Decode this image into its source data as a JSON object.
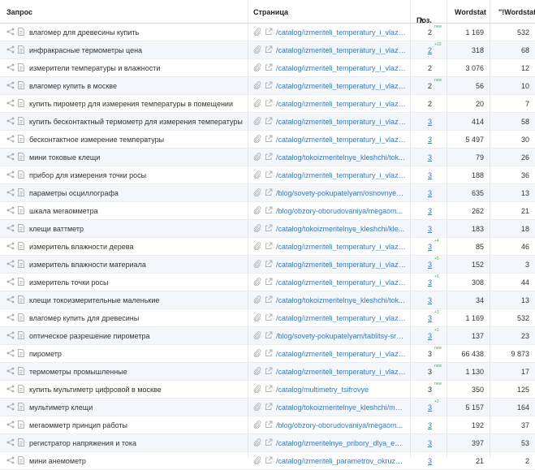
{
  "headers": {
    "query": "Запрос",
    "page": "Страница",
    "pos": "Поз.",
    "wordstat": "Wordstat",
    "exact_wordstat": "\"!Wordstat\""
  },
  "icons": {
    "share": "share-icon",
    "doc": "document-icon",
    "clip": "paperclip-icon",
    "link": "external-link-icon",
    "sort": "sort-up-chevron-icon"
  },
  "colors": {
    "link": "#3a78b5",
    "delta": "#4caf50",
    "alt_row": "#f3f7fb"
  },
  "rows": [
    {
      "query": "влагомер для древесины купить",
      "url": "/catalog/izmeriteli_temperatury_i_vlazh...",
      "pos": "2",
      "delta": "new",
      "ws": "1 169",
      "ews": "532",
      "linked": false
    },
    {
      "query": "инфракрасные термометры цена",
      "url": "/catalog/izmeriteli_temperatury_i_vlazh...",
      "pos": "2",
      "delta": "+13",
      "ws": "318",
      "ews": "68",
      "linked": true
    },
    {
      "query": "измерители температуры и влажности",
      "url": "/catalog/izmeriteli_temperatury_i_vlazh...",
      "pos": "2",
      "delta": "",
      "ws": "3 076",
      "ews": "12",
      "linked": false
    },
    {
      "query": "влагомер купить в москве",
      "url": "/catalog/izmeriteli_temperatury_i_vlazh...",
      "pos": "2",
      "delta": "new",
      "ws": "56",
      "ews": "10",
      "linked": false
    },
    {
      "query": "купить пирометр для измерения температуры в помещении",
      "url": "/catalog/izmeriteli_temperatury_i_vlazh...",
      "pos": "2",
      "delta": "",
      "ws": "20",
      "ews": "7",
      "linked": false
    },
    {
      "query": "купить бесконтактный термометр для измерения температуры",
      "url": "/catalog/izmeriteli_temperatury_i_vlazh...",
      "pos": "3",
      "delta": "",
      "ws": "414",
      "ews": "58",
      "linked": true
    },
    {
      "query": "бесконтактное измерение температуры",
      "url": "/catalog/izmeriteli_temperatury_i_vlazh...",
      "pos": "3",
      "delta": "",
      "ws": "5 497",
      "ews": "30",
      "linked": true
    },
    {
      "query": "мини токовые клещи",
      "url": "/catalog/tokoizmeritelnye_kleshchi/tok...",
      "pos": "3",
      "delta": "",
      "ws": "79",
      "ews": "26",
      "linked": true
    },
    {
      "query": "прибор для измерения точки росы",
      "url": "/catalog/izmeriteli_temperatury_i_vlazh...",
      "pos": "3",
      "delta": "",
      "ws": "188",
      "ews": "36",
      "linked": true
    },
    {
      "query": "параметры осциллографа",
      "url": "/blog/sovety-pokupatelyam/osnovnye-k...",
      "pos": "3",
      "delta": "",
      "ws": "635",
      "ews": "13",
      "linked": true
    },
    {
      "query": "шкала мегаомметра",
      "url": "/blog/obzory-oborudovaniya/megaom...",
      "pos": "3",
      "delta": "",
      "ws": "262",
      "ews": "21",
      "linked": true
    },
    {
      "query": "клещи ваттметр",
      "url": "/catalog/tokoizmeritelnye_kleshchi/kle...",
      "pos": "3",
      "delta": "",
      "ws": "183",
      "ews": "18",
      "linked": true
    },
    {
      "query": "измеритель влажности дерева",
      "url": "/catalog/izmeriteli_temperatury_i_vlazh...",
      "pos": "3",
      "delta": "+4",
      "ws": "85",
      "ews": "46",
      "linked": true
    },
    {
      "query": "измеритель влажности материала",
      "url": "/catalog/izmeriteli_temperatury_i_vlazh...",
      "pos": "3",
      "delta": "+5",
      "ws": "152",
      "ews": "3",
      "linked": true
    },
    {
      "query": "измеритель точки росы",
      "url": "/catalog/izmeriteli_temperatury_i_vlazh...",
      "pos": "3",
      "delta": "+6",
      "ws": "308",
      "ews": "44",
      "linked": true
    },
    {
      "query": "клещи токоизмерительные маленькие",
      "url": "/catalog/tokoizmeritelnye_kleshchi/tok...",
      "pos": "3",
      "delta": "",
      "ws": "34",
      "ews": "13",
      "linked": true
    },
    {
      "query": "влагомер купить для древесины",
      "url": "/catalog/izmeriteli_temperatury_i_vlazh...",
      "pos": "3",
      "delta": "+3",
      "ws": "1 169",
      "ews": "532",
      "linked": true
    },
    {
      "query": "оптическое разрешение пирометра",
      "url": "/blog/sovety-pokupatelyam/tablitsy-sra...",
      "pos": "3",
      "delta": "+1",
      "ws": "137",
      "ews": "23",
      "linked": true
    },
    {
      "query": "пирометр",
      "url": "/catalog/izmeriteli_temperatury_i_vlazh...",
      "pos": "3",
      "delta": "new",
      "ws": "66 438",
      "ews": "9 873",
      "linked": false
    },
    {
      "query": "термометры промышленные",
      "url": "/catalog/izmeriteli_temperatury_i_vlazh...",
      "pos": "3",
      "delta": "new",
      "ws": "1 130",
      "ews": "17",
      "linked": false
    },
    {
      "query": "купить мультиметр цифровой в москве",
      "url": "/catalog/multimetry_tsifrovye",
      "pos": "3",
      "delta": "new",
      "ws": "350",
      "ews": "125",
      "linked": false
    },
    {
      "query": "мультиметр клещи",
      "url": "/catalog/tokoizmeritelnye_kleshchi/mul...",
      "pos": "3",
      "delta": "+2",
      "ws": "5 157",
      "ews": "164",
      "linked": true
    },
    {
      "query": "мегаомметр принцип работы",
      "url": "/blog/obzory-oborudovaniya/megaom...",
      "pos": "3",
      "delta": "",
      "ws": "192",
      "ews": "37",
      "linked": true
    },
    {
      "query": "регистратор напряжения и тока",
      "url": "/catalog/izmeritelnye_pribory_dlya_ener...",
      "pos": "3",
      "delta": "",
      "ws": "397",
      "ews": "53",
      "linked": true
    },
    {
      "query": "мини анемометр",
      "url": "/catalog/izmeriteli_parametrov_okruzha...",
      "pos": "3",
      "delta": "",
      "ws": "21",
      "ews": "2",
      "linked": true
    }
  ]
}
